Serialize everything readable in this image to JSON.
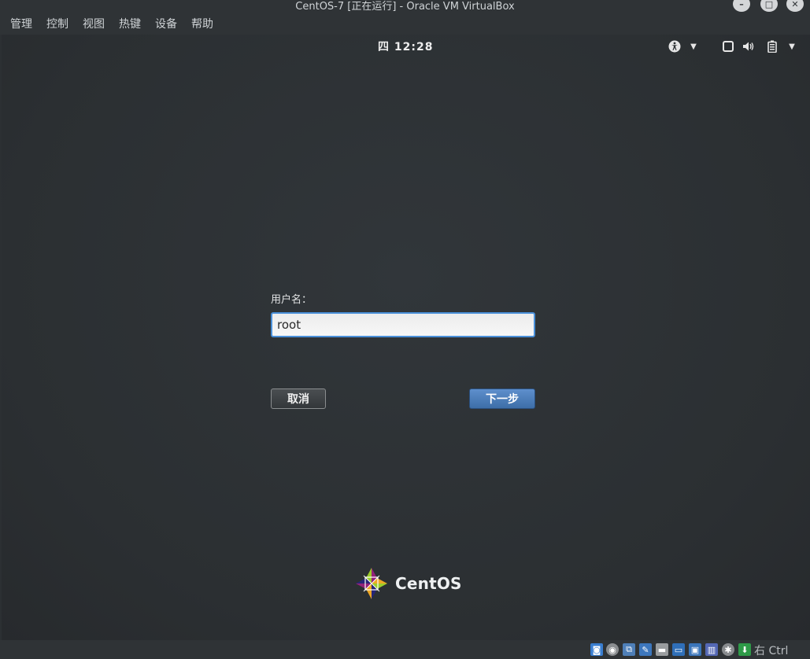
{
  "window": {
    "title": "CentOS-7 [正在运行] - Oracle VM VirtualBox"
  },
  "menu": {
    "items": [
      "管理",
      "控制",
      "视图",
      "热键",
      "设备",
      "帮助"
    ]
  },
  "guest": {
    "clock": "四 12:28",
    "icons": [
      "accessibility-icon",
      "screen-icon",
      "volume-icon",
      "battery-icon"
    ],
    "login": {
      "username_label": "用户名：",
      "username_value": "root",
      "cancel_label": "取消",
      "next_label": "下一步"
    },
    "brand_text": "CentOS"
  },
  "statusbar": {
    "icons": [
      "hard-disk-icon",
      "optical-drive-icon",
      "network-icon",
      "usb-icon",
      "shared-folders-icon",
      "display-icon",
      "video-capture-icon",
      "cpu-icon",
      "mouse-integration-icon",
      "keyboard-icon"
    ],
    "host_key": "右 Ctrl"
  },
  "colors": {
    "accent": "#4a90d9",
    "next_button": "#4a7fbf",
    "background": "#2c3033"
  }
}
